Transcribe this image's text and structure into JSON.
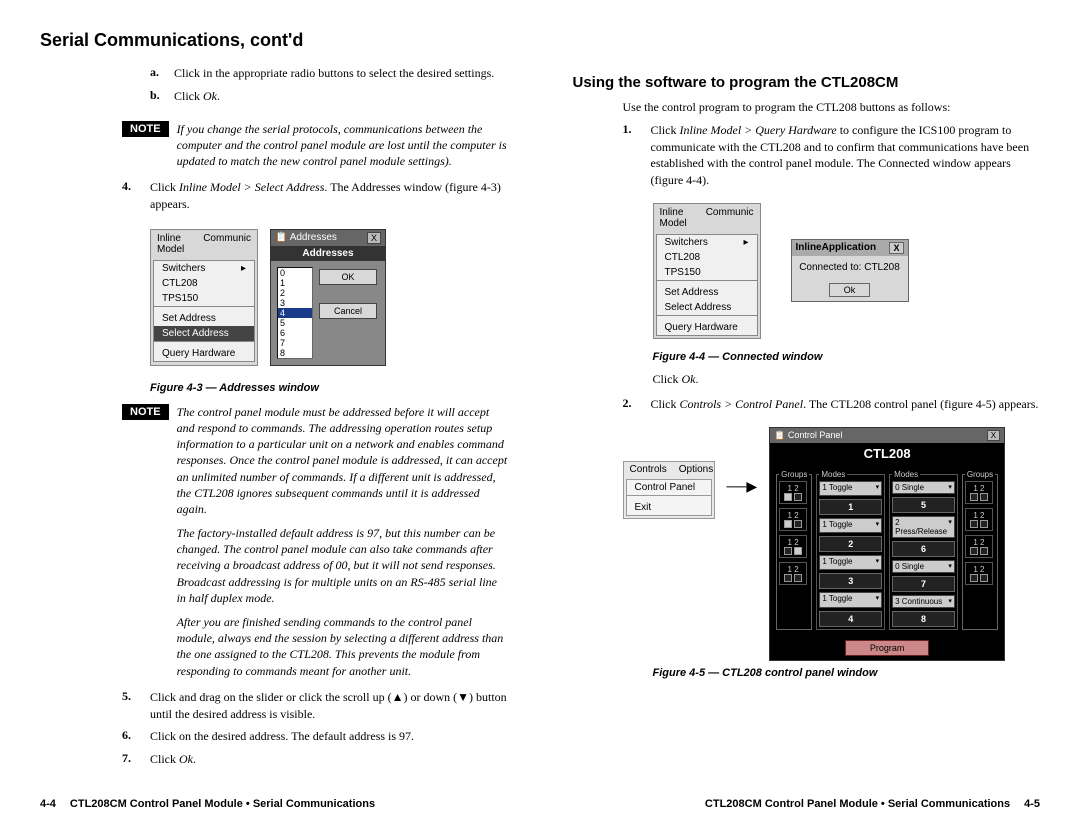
{
  "headings": {
    "main": "Serial Communications, cont'd",
    "using": "Using the software to program the CTL208CM"
  },
  "left": {
    "a": "Click in the appropriate radio buttons to select the desired settings.",
    "b_prefix": "Click ",
    "b_ital": "Ok",
    "b_suffix": ".",
    "note1": "If you change the serial protocols, communications between the computer and the control panel module are lost until the computer is updated to match the new control panel module settings).",
    "step4_prefix": "Click ",
    "step4_ital": "Inline Model > Select Address",
    "step4_suffix": ".  The Addresses window (figure 4-3) appears.",
    "fig43_caption": "Figure 4-3 — Addresses window",
    "note2a": "The control panel module must be addressed before it will accept and respond to commands.  The addressing operation routes setup information to a particular unit on a network and enables command responses.  Once the control panel module is addressed, it can accept an unlimited number of commands.  If a different unit is addressed, the CTL208 ignores subsequent commands until it is addressed again.",
    "note2b": "The factory-installed default address is 97, but this number can be changed.  The control panel module can also take commands after receiving a broadcast address of 00, but it will not send responses.  Broadcast addressing is for multiple units on an RS-485 serial line in half duplex mode.",
    "note2c": "After you are finished sending commands to the control panel module, always end the session by selecting a different address than the one assigned to the CTL208. This prevents the module from responding to commands meant for another unit.",
    "step5": "Click and drag on the slider or click the scroll up (▲) or down (▼) button until the desired address is visible.",
    "step6": "Click on the desired address.  The default address is 97.",
    "step7_prefix": "Click ",
    "step7_ital": "Ok",
    "step7_suffix": "."
  },
  "right": {
    "intro": "Use the control program to program the CTL208 buttons as follows:",
    "step1_prefix": "Click ",
    "step1_ital": "Inline Model > Query Hardware",
    "step1_suffix": " to configure the ICS100 program to communicate with the CTL208 and to confirm that communications have been established with the control panel module.  The Connected window appears (figure 4-4).",
    "fig44_caption": "Figure 4-4 — Connected window",
    "clickok_prefix": "Click ",
    "clickok_ital": "Ok",
    "clickok_suffix": ".",
    "step2_prefix": "Click ",
    "step2_ital": "Controls > Control Panel",
    "step2_suffix": ".  The CTL208 control panel (figure 4-5) appears.",
    "fig45_caption": "Figure 4-5 — CTL208 control panel window"
  },
  "fig43": {
    "menu_head1": "Inline Model",
    "menu_head2": "Communic",
    "sub1": "Switchers",
    "sub2": "CTL208",
    "sub3": "TPS150",
    "sub4": "Set Address",
    "sub5": "Select Address",
    "sub6": "Query Hardware",
    "title": "Addresses",
    "header": "Addresses",
    "n0": "0",
    "n1": "1",
    "n2": "2",
    "n3": "3",
    "n4": "4",
    "n5": "5",
    "n6": "6",
    "n7": "7",
    "n8": "8",
    "ok": "OK",
    "cancel": "Cancel",
    "arrow": "▸"
  },
  "fig44": {
    "menu_head1": "Inline Model",
    "menu_head2": "Communic",
    "sub1": "Switchers",
    "sub2": "CTL208",
    "sub3": "TPS150",
    "sub4": "Set Address",
    "sub5": "Select Address",
    "sub6": "Query Hardware",
    "app_title": "InlineApplication",
    "msg": "Connected to: CTL208",
    "ok": "Ok",
    "x": "X",
    "arrow": "▸"
  },
  "fig45": {
    "menu_head1": "Controls",
    "menu_head2": "Options",
    "sub1": "Control Panel",
    "sub2": "Exit",
    "win_title": "Control Panel",
    "device": "CTL208",
    "groups": "Groups",
    "modes": "Modes",
    "nums": "1  2",
    "d_toggle": "1 Toggle",
    "d_single": "0 Single",
    "d_press": "2 Press/Release",
    "d_cont": "3 Continuous",
    "b1": "1",
    "b2": "2",
    "b3": "3",
    "b4": "4",
    "b5": "5",
    "b6": "6",
    "b7": "7",
    "b8": "8",
    "program": "Program",
    "arrow": "▾",
    "x": "X"
  },
  "footer": {
    "left_num": "4-4",
    "left_text": "CTL208CM Control Panel Module • Serial Communications",
    "right_text": "CTL208CM Control Panel Module • Serial Communications",
    "right_num": "4-5"
  },
  "labels": {
    "note": "NOTE"
  }
}
